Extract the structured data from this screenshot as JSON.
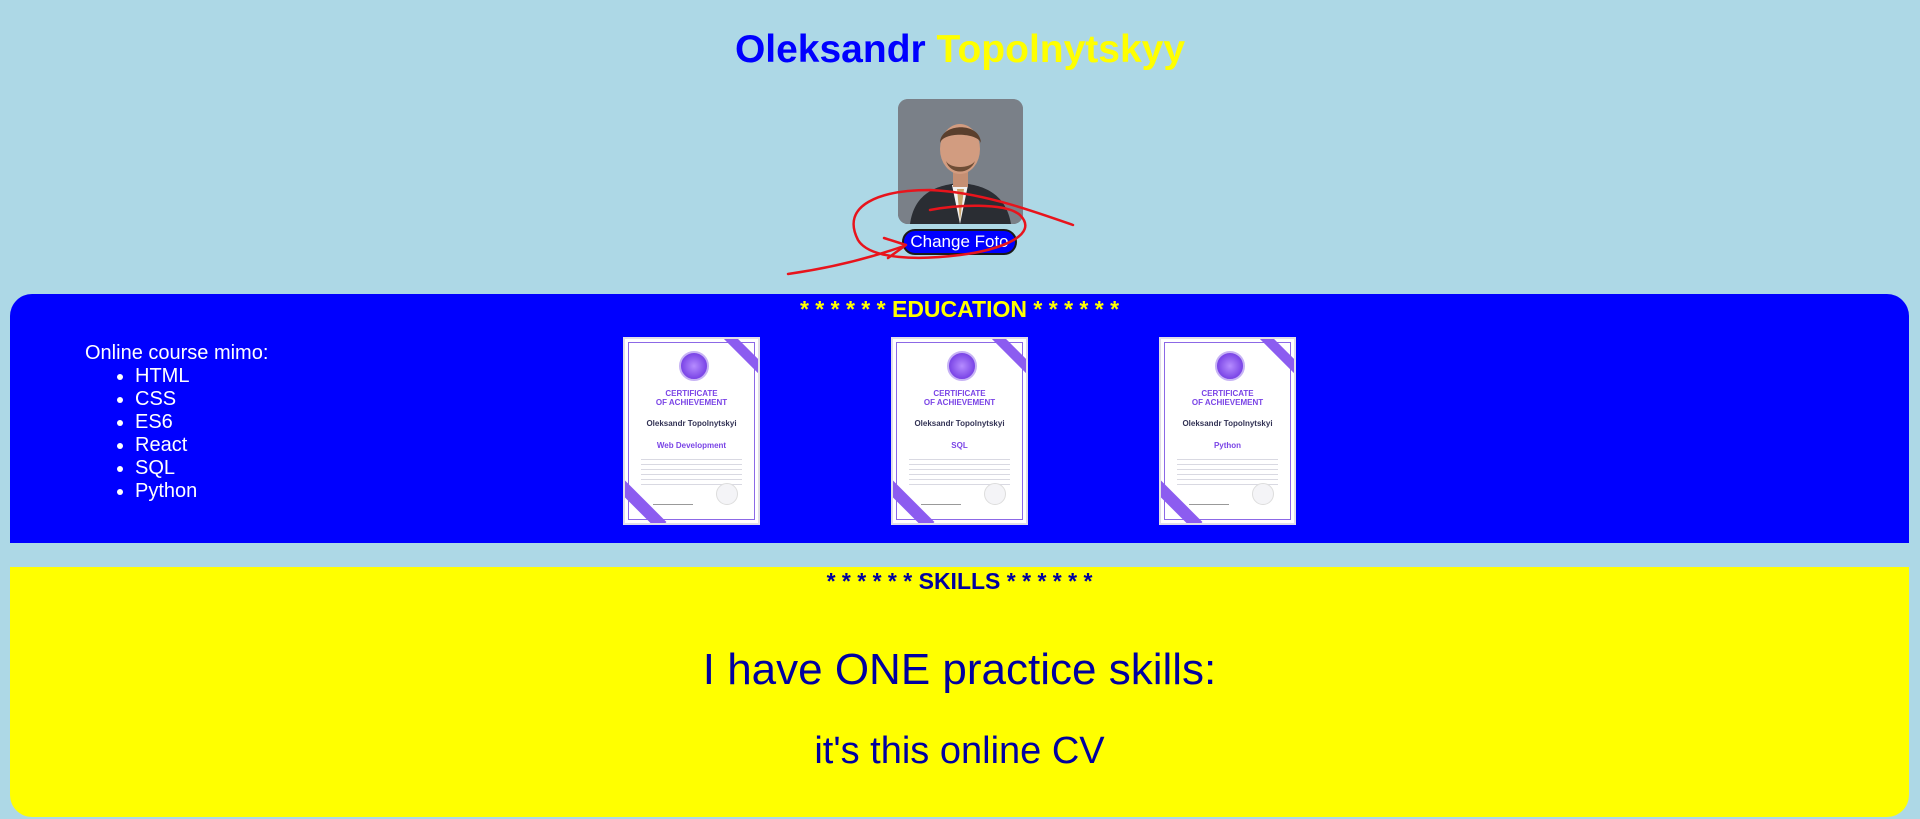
{
  "header": {
    "first_name": "Oleksandr",
    "last_name": "Topolnytskyy"
  },
  "profile": {
    "change_photo_label": "Change Foto"
  },
  "education": {
    "title": "* * * * * * EDUCATION * * * * * *",
    "intro": "Online course mimo:",
    "courses": [
      "HTML",
      "CSS",
      "ES6",
      "React",
      "SQL",
      "Python"
    ],
    "certificates": [
      {
        "heading_line1": "CERTIFICATE",
        "heading_line2": "OF ACHIEVEMENT",
        "name": "Oleksandr Topolnytskyi",
        "course": "Web Development"
      },
      {
        "heading_line1": "CERTIFICATE",
        "heading_line2": "OF ACHIEVEMENT",
        "name": "Oleksandr Topolnytskyi",
        "course": "SQL"
      },
      {
        "heading_line1": "CERTIFICATE",
        "heading_line2": "OF ACHIEVEMENT",
        "name": "Oleksandr Topolnytskyi",
        "course": "Python"
      }
    ]
  },
  "skills": {
    "title": "* * * * * * SKILLS * * * * * *",
    "statement": "I have ONE practice skills:",
    "detail": "it's this online CV"
  },
  "colors": {
    "page_background": "#add8e6",
    "education_background": "#0000ff",
    "skills_background": "#ffff00",
    "accent_yellow": "#ffff00",
    "accent_blue": "#0000ff",
    "annotation_red": "#e8141c"
  }
}
